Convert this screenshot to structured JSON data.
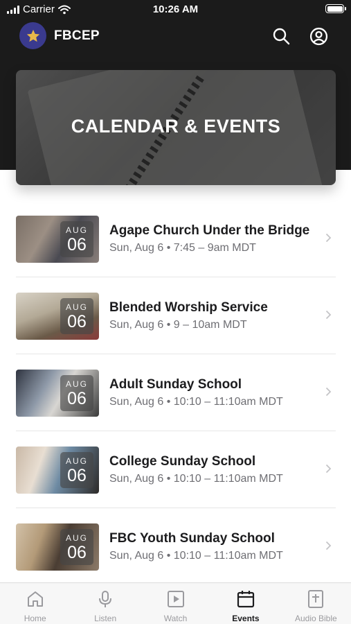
{
  "status_bar": {
    "carrier": "Carrier",
    "time": "10:26 AM"
  },
  "header": {
    "brand": "FBCEP"
  },
  "hero": {
    "title": "CALENDAR & EVENTS"
  },
  "events": [
    {
      "title": "Agape Church Under the Bridge",
      "meta": "Sun, Aug 6 • 7:45 – 9am MDT",
      "month": "AUG",
      "day": "06"
    },
    {
      "title": "Blended Worship Service",
      "meta": "Sun, Aug 6 • 9 – 10am MDT",
      "month": "AUG",
      "day": "06"
    },
    {
      "title": "Adult Sunday School",
      "meta": "Sun, Aug 6 • 10:10 – 11:10am MDT",
      "month": "AUG",
      "day": "06"
    },
    {
      "title": "College Sunday School",
      "meta": "Sun, Aug 6 • 10:10 – 11:10am MDT",
      "month": "AUG",
      "day": "06"
    },
    {
      "title": "FBC Youth Sunday School",
      "meta": "Sun, Aug 6 • 10:10 – 11:10am MDT",
      "month": "AUG",
      "day": "06"
    }
  ],
  "tabs": [
    {
      "label": "Home",
      "icon": "home-icon",
      "active": false
    },
    {
      "label": "Listen",
      "icon": "microphone-icon",
      "active": false
    },
    {
      "label": "Watch",
      "icon": "play-icon",
      "active": false
    },
    {
      "label": "Events",
      "icon": "calendar-icon",
      "active": true
    },
    {
      "label": "Audio Bible",
      "icon": "bible-icon",
      "active": false
    }
  ],
  "colors": {
    "header_bg": "#1b1b1b",
    "logo_bg": "#3a3a8e",
    "star": "#e8b84a",
    "active_tab": "#1c1c1e",
    "inactive_tab": "#9a9a9e"
  }
}
